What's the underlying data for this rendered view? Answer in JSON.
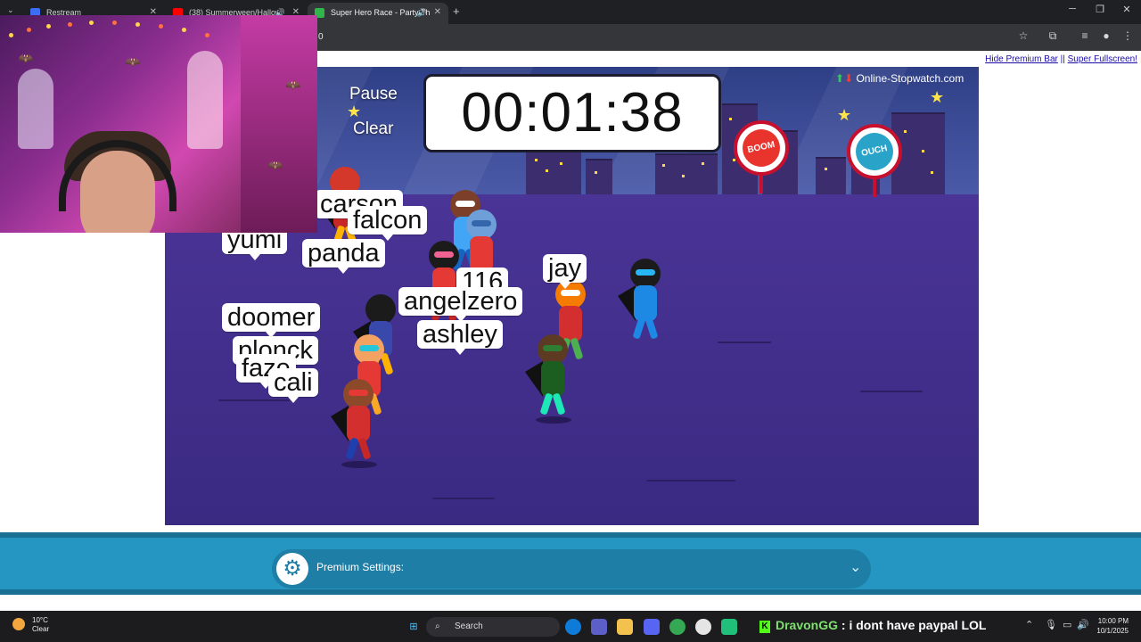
{
  "browser": {
    "tabs": [
      {
        "title": "Restream",
        "active": false
      },
      {
        "title": "(38) Summerween/Hallow",
        "active": false
      },
      {
        "title": "Super Hero Race - Party Th",
        "active": true
      }
    ],
    "new_tab": "+",
    "url_fragment": "0"
  },
  "page": {
    "links": {
      "hide_premium": "Hide Premium Bar",
      "separator": " || ",
      "super_fullscreen": "Super Fullscreen!"
    }
  },
  "game": {
    "controls": {
      "pause": "Pause",
      "clear": "Clear"
    },
    "timer": "00:01:38",
    "brand": "Online-Stopwatch.com",
    "badges": {
      "boom": "BOOM",
      "ouch": "OUCH"
    },
    "racers": [
      "carson",
      "falcon",
      "yumi",
      "panda",
      "jay",
      "116",
      "angelzero",
      "ashley",
      "doomer",
      "plonck",
      "faze",
      "cali"
    ],
    "racer_labels": {
      "carson": "carson",
      "falcon": "falcon",
      "yumi": "yumi",
      "panda": "panda",
      "jay": "jay",
      "n116": "116",
      "angelzero": "angelzero",
      "ashley": "ashley",
      "doomer": "doomer",
      "plonck": "plonck",
      "faze": "faze",
      "cali": "cali"
    }
  },
  "premium": {
    "label": "Premium Settings:"
  },
  "taskbar": {
    "weather": {
      "temp": "10°C",
      "condition": "Clear"
    },
    "search": "Search",
    "chat": {
      "user": "DravonGG",
      "message": " : i dont have paypal LOL"
    },
    "time": "10:00 PM",
    "date": "10/1/2025"
  },
  "colors": {
    "premium_bar": "#2596c2",
    "sky": "#4a5aa8",
    "ground": "#3e2a86"
  }
}
